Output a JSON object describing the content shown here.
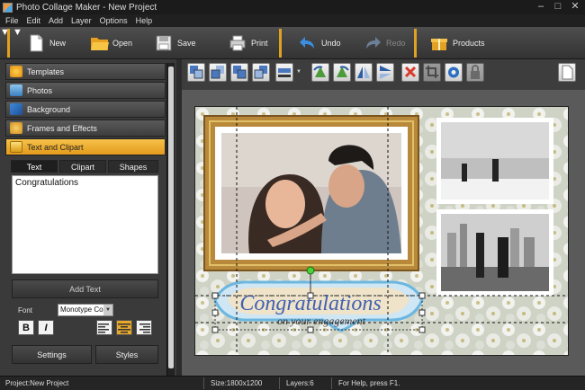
{
  "window": {
    "title": "Photo Collage Maker - New Project",
    "controls": [
      "–",
      "□",
      "✕"
    ]
  },
  "menu": [
    "File",
    "Edit",
    "Add",
    "Layer",
    "Options",
    "Help"
  ],
  "toolbar": {
    "new": "New",
    "open": "Open",
    "save": "Save",
    "print": "Print",
    "undo": "Undo",
    "redo": "Redo",
    "products": "Products"
  },
  "left_panel": {
    "sections": [
      "Templates",
      "Photos",
      "Background",
      "Frames and Effects",
      "Text and Clipart"
    ],
    "tabs": [
      "Text",
      "Clipart",
      "Shapes"
    ],
    "text_value": "Congratulations",
    "add_text": "Add Text",
    "font_label": "Font",
    "font_value": "Monotype Corsiva",
    "bold": "B",
    "italic": "I",
    "settings": "Settings",
    "styles": "Styles"
  },
  "canvas": {
    "main_text": "Congratulations",
    "sub_text": "on your engagement"
  },
  "status": {
    "project": "Project:New Project",
    "size": "Size:1800x1200",
    "layers": "Layers:6",
    "help": "For Help, press F1."
  },
  "colors": {
    "accent": "#f0b030",
    "active_tab": "#e9a82a",
    "frame_gold": "#b8893a"
  }
}
